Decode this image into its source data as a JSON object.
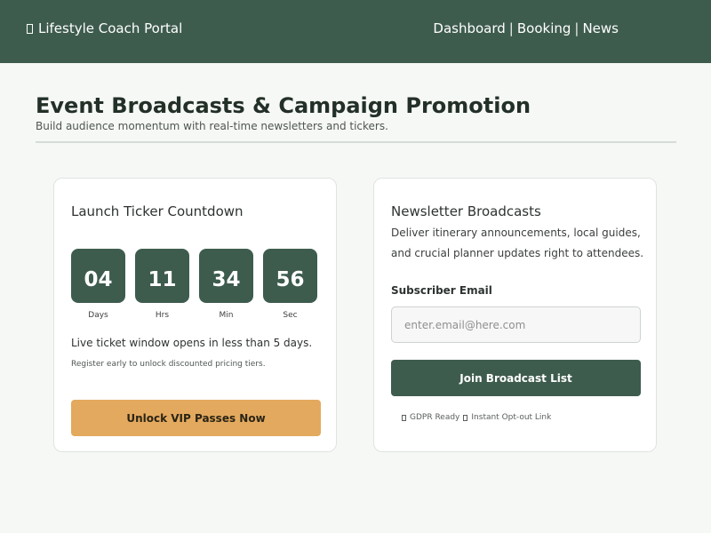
{
  "header": {
    "brand_icon": "portal-glyph-icon",
    "brand": "Lifestyle Coach Portal",
    "nav": [
      "Dashboard",
      "Booking",
      "News"
    ],
    "nav_separator": "|"
  },
  "page": {
    "title": "Event Broadcasts & Campaign Promotion",
    "subtitle": "Build audience momentum with real-time newsletters and tickers."
  },
  "ticker": {
    "title": "Launch Ticker Countdown",
    "units": [
      {
        "value": "04",
        "label": "Days"
      },
      {
        "value": "11",
        "label": "Hrs"
      },
      {
        "value": "34",
        "label": "Min"
      },
      {
        "value": "56",
        "label": "Sec"
      }
    ],
    "note": "Live ticket window opens in less than 5 days.",
    "subnote": "Register early to unlock discounted pricing tiers.",
    "cta_label": "Unlock VIP Passes Now"
  },
  "newsletter": {
    "title": "Newsletter Broadcasts",
    "description": "Deliver itinerary announcements, local guides, and crucial planner updates right to attendees.",
    "email_label": "Subscriber Email",
    "email_placeholder": "enter.email@here.com",
    "email_value": "",
    "join_label": "Join Broadcast List",
    "badges": [
      {
        "icon": "gdpr-icon",
        "text": "GDPR Ready"
      },
      {
        "icon": "opt-out-icon",
        "text": "Instant Opt-out Link"
      }
    ]
  },
  "colors": {
    "header_bg": "#3e5c4e",
    "accent_green": "#3e5c4e",
    "cta_orange": "#e3a95e",
    "page_bg": "#f6f8f6"
  }
}
